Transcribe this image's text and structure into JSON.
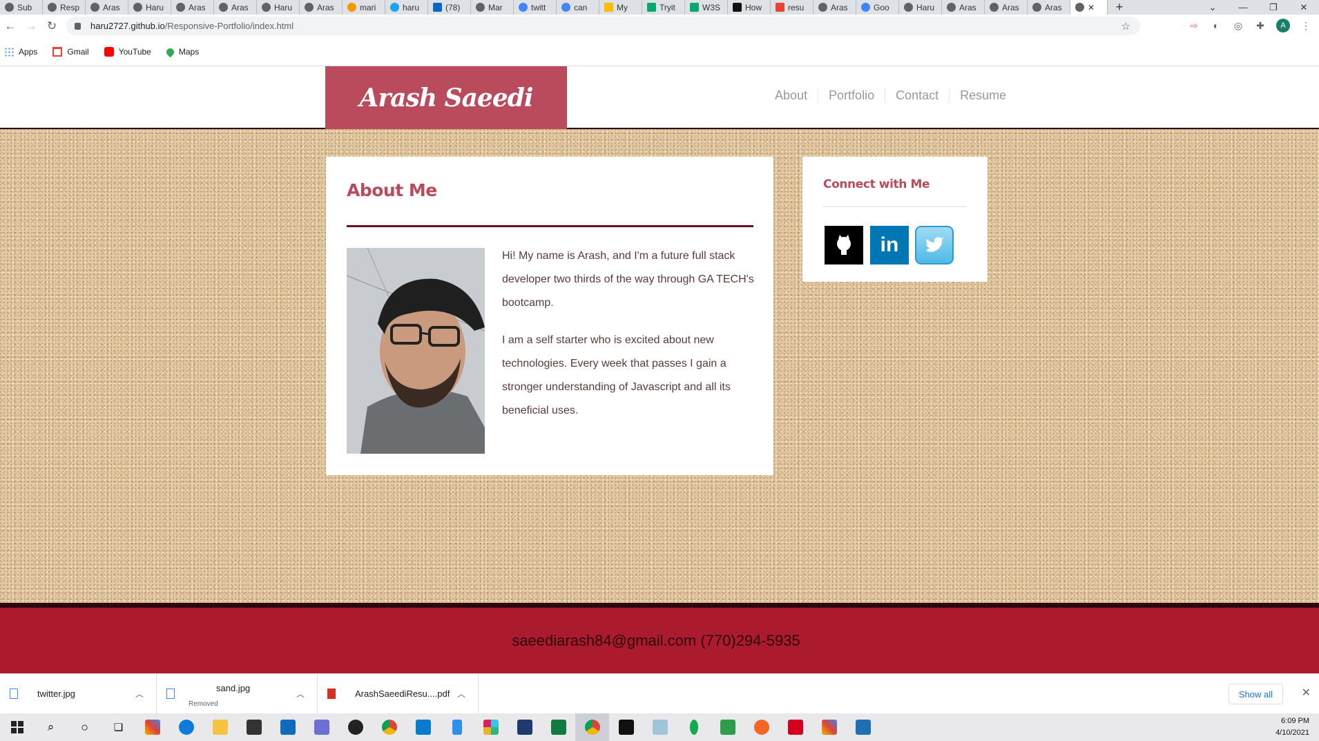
{
  "browser": {
    "tabs": [
      "Sub",
      "Resp",
      "Aras",
      "Haru",
      "Aras",
      "Aras",
      "Haru",
      "Aras",
      "mari",
      "haru",
      "(78)",
      "Mar",
      "twitt",
      "can",
      "My",
      "Tryit",
      "W3S",
      "How",
      "resu",
      "Aras",
      "Goo",
      "Haru",
      "Aras",
      "Aras",
      "Aras",
      ""
    ],
    "window_controls": [
      "⌄",
      "—",
      "❐",
      "✕"
    ],
    "new_tab": "+",
    "url_host": "haru2727.github.io",
    "url_path": "/Responsive-Portfolio/index.html",
    "profile_initial": "A",
    "bookmarks": [
      {
        "label": "Apps",
        "icon": "apps-grid-icon"
      },
      {
        "label": "Gmail",
        "icon": "gmail-icon"
      },
      {
        "label": "YouTube",
        "icon": "youtube-icon"
      },
      {
        "label": "Maps",
        "icon": "maps-pin-icon"
      }
    ]
  },
  "site": {
    "brand": "Arash Saeedi",
    "nav": [
      "About",
      "Portfolio",
      "Contact",
      "Resume"
    ],
    "about": {
      "title": "About Me",
      "para1": "Hi! My name is Arash, and I'm a future full stack developer two thirds of the way through GA TECH's bootcamp.",
      "para2": "I am a self starter who is excited about new technologies. Every week that passes I gain a stronger understanding of Javascript and all its beneficial uses."
    },
    "connect": {
      "title": "Connect with Me",
      "linkedin_text": "in"
    },
    "footer": "saeediarash84@gmail.com (770)294-5935"
  },
  "downloads": {
    "items": [
      {
        "name": "twitter.jpg",
        "status": ""
      },
      {
        "name": "sand.jpg",
        "status": "Removed"
      },
      {
        "name": "ArashSaeediResu....pdf",
        "status": ""
      }
    ],
    "show_all": "Show all"
  },
  "taskbar": {
    "time": "6:09 PM",
    "date": "4/10/2021"
  }
}
